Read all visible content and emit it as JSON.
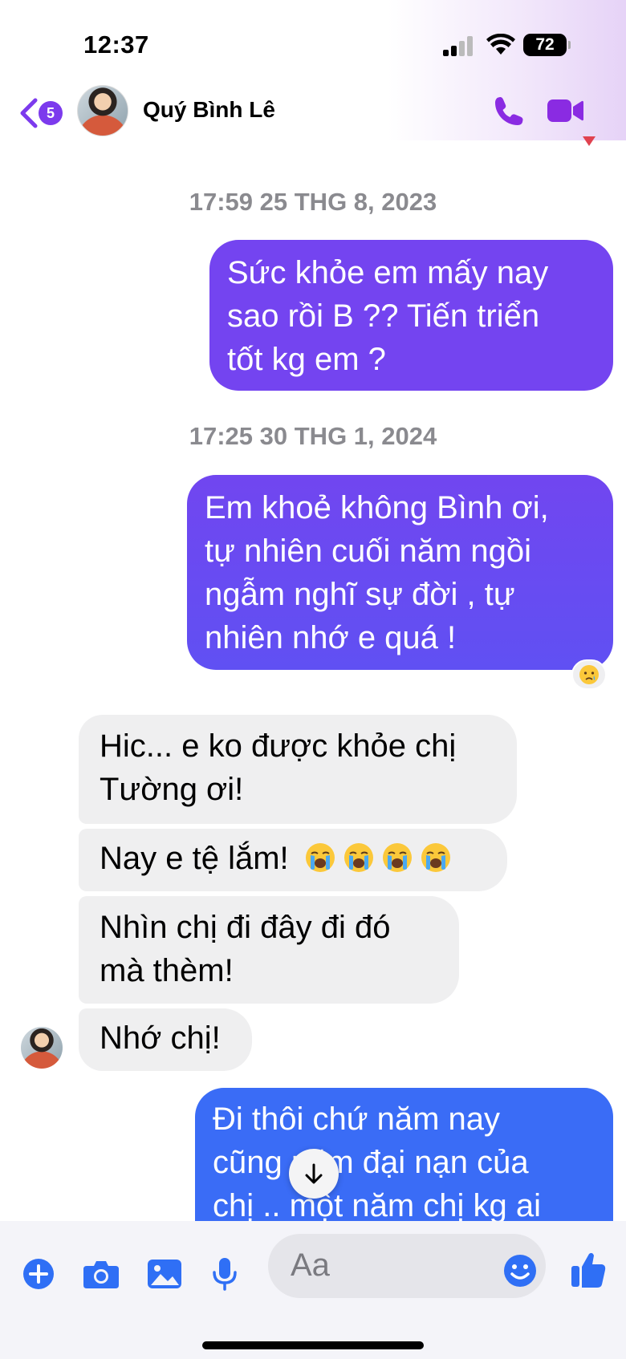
{
  "status": {
    "time": "12:37",
    "battery": "72"
  },
  "header": {
    "unread_count": "5",
    "contact_name": "Quý Bình Lê"
  },
  "messages": {
    "ts1": "17:59 25 THG 8, 2023",
    "ts2": "17:25 30 THG 1, 2024",
    "m1": [
      "Sức khỏe em mấy nay",
      "sao rồi B ?? Tiến triển",
      "tốt kg em ?"
    ],
    "m2": [
      "Em khoẻ không Bình ơi,",
      "tự nhiên cuối năm ngồi",
      "ngẫm nghĩ sự đời , tự",
      "nhiên nhớ e quá !"
    ],
    "m3": [
      "Hic... e ko được khỏe chị",
      "Tường ơi!"
    ],
    "m4": "Nay e tệ lắm!",
    "m5": [
      "Nhìn chị đi đây đi đó",
      "mà thèm!"
    ],
    "m6": "Nhớ chị!",
    "m7": [
      "Đi thôi chứ năm nay",
      "cũng năm đại nạn của",
      "chị .. một năm chị kg ai"
    ]
  },
  "composer": {
    "placeholder": "Aa"
  },
  "colors": {
    "accent": "#7c3aed",
    "bubble_m1": "#7444f0",
    "bubble_m2": "#6a4cf2",
    "bubble_m7": "#3a6cf6",
    "incoming_bubble": "#efeff0",
    "composer_icons": "#2f6ff5"
  },
  "icons": [
    "back-chevron-icon",
    "phone-icon",
    "video-camera-icon",
    "crying-emoji-icon",
    "arrow-down-icon",
    "plus-icon",
    "camera-icon",
    "image-icon",
    "microphone-icon",
    "smiley-icon",
    "thumbs-up-icon"
  ]
}
